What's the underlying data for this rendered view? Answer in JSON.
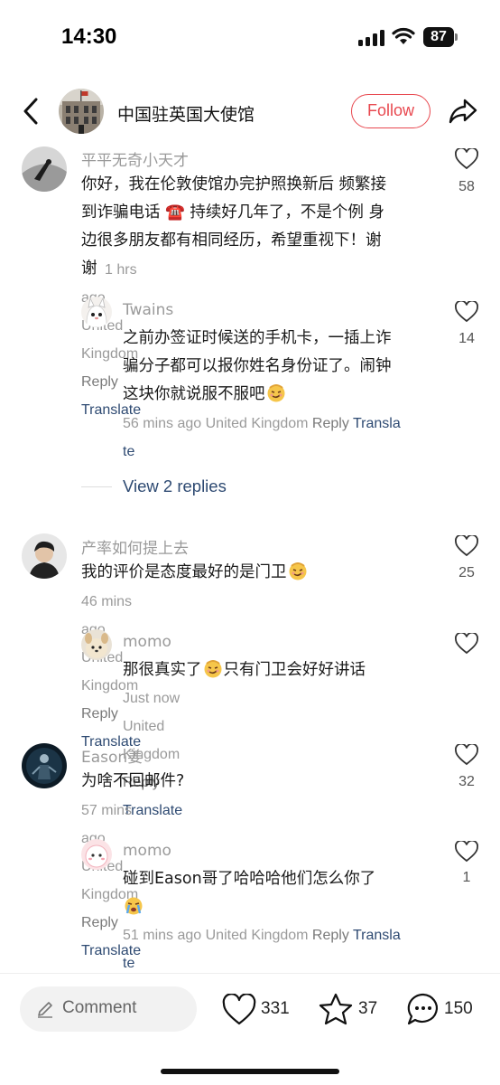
{
  "status": {
    "time": "14:30",
    "battery": "87"
  },
  "header": {
    "title": "中国驻英国大使馆",
    "follow_label": "Follow"
  },
  "comments": [
    {
      "user": "平平无奇小天才",
      "lines": [
        "你好，我在伦敦使馆办完护照换新后 频繁接",
        "到诈骗电话 ☎️ 持续好几年了，不是个例 身",
        "边很多朋友都有相同经历，希望重视下！谢",
        "谢"
      ],
      "time": "1 hrs ago",
      "location": "United Kingdom",
      "reply": "Reply",
      "translate": "Translate",
      "likes": "58"
    },
    {
      "user": "Twains",
      "lines": [
        "之前办签证时候送的手机卡，一插上诈",
        "骗分子都可以报你姓名身份证了。闹钟",
        "这块你就说服不服吧"
      ],
      "time": "56 mins ago",
      "location": "United Kingdom",
      "reply": "Reply",
      "translate_a": "Transla",
      "translate_b": "te",
      "likes": "14"
    },
    {
      "user": "产率如何提上去",
      "lines": [
        "我的评价是态度最好的是门卫"
      ],
      "time": "46 mins ago",
      "location": "United Kingdom",
      "reply": "Reply",
      "translate": "Translate",
      "likes": "25"
    },
    {
      "user": "momo",
      "lines_a": "那很真实了",
      "lines_b": "只有门卫会好好讲话",
      "time": "Just now",
      "location": "United Kingdom",
      "reply": "Reply",
      "translate": "Translate",
      "likes": ""
    },
    {
      "user": "Eason姜",
      "lines": [
        "为啥不回邮件?"
      ],
      "time": "57 mins ago",
      "location": "United Kingdom",
      "reply": "Reply",
      "translate": "Translate",
      "likes": "32"
    },
    {
      "user": "momo",
      "lines": [
        "碰到Eason哥了哈哈哈他们怎么你了"
      ],
      "time": "51 mins ago",
      "location": "United Kingdom",
      "reply": "Reply",
      "translate_a": "Transla",
      "translate_b": "te",
      "likes": "1"
    }
  ],
  "view_replies": "View 2 replies",
  "bottom": {
    "comment_placeholder": "Comment",
    "likes": "331",
    "stars": "37",
    "comments": "150"
  },
  "colors": {
    "accent": "#e8484f",
    "link": "#2e4a72",
    "muted": "#9a9a9a"
  },
  "icons": [
    "back-arrow-icon",
    "share-icon",
    "heart-icon",
    "pen-icon",
    "star-icon",
    "chat-bubble-icon",
    "telephone-emoji",
    "smirk-face-emoji",
    "crying-face-emoji"
  ]
}
